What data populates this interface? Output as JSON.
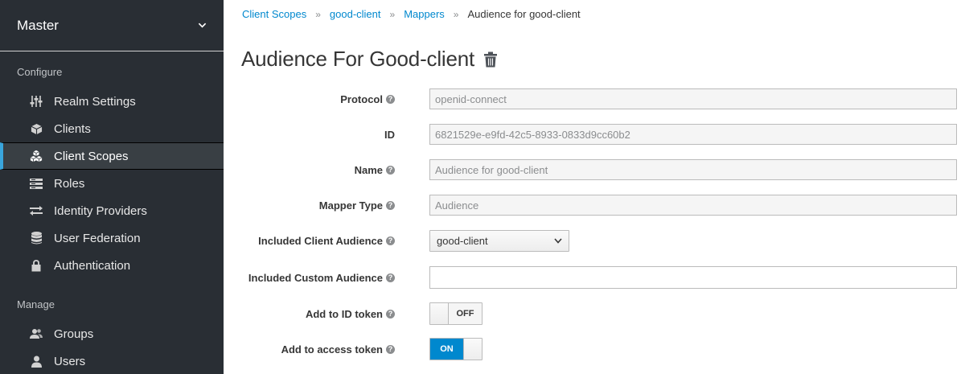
{
  "sidebar": {
    "realm": "Master",
    "configure_label": "Configure",
    "manage_label": "Manage",
    "configure_items": [
      {
        "label": "Realm Settings",
        "icon": "sliders-icon"
      },
      {
        "label": "Clients",
        "icon": "cube-icon"
      },
      {
        "label": "Client Scopes",
        "icon": "cubes-icon",
        "active": true
      },
      {
        "label": "Roles",
        "icon": "list-icon"
      },
      {
        "label": "Identity Providers",
        "icon": "exchange-icon"
      },
      {
        "label": "User Federation",
        "icon": "database-icon"
      },
      {
        "label": "Authentication",
        "icon": "lock-icon"
      }
    ],
    "manage_items": [
      {
        "label": "Groups",
        "icon": "users-icon"
      },
      {
        "label": "Users",
        "icon": "user-icon"
      }
    ]
  },
  "breadcrumb": {
    "items": [
      "Client Scopes",
      "good-client",
      "Mappers"
    ],
    "current": "Audience for good-client"
  },
  "page": {
    "title": "Audience For Good-client"
  },
  "form": {
    "protocol": {
      "label": "Protocol",
      "value": "openid-connect"
    },
    "id": {
      "label": "ID",
      "value": "6821529e-e9fd-42c5-8933-0833d9cc60b2"
    },
    "name": {
      "label": "Name",
      "value": "Audience for good-client"
    },
    "mapper_type": {
      "label": "Mapper Type",
      "value": "Audience"
    },
    "included_client_audience": {
      "label": "Included Client Audience",
      "value": "good-client"
    },
    "included_custom_audience": {
      "label": "Included Custom Audience",
      "value": ""
    },
    "add_to_id_token": {
      "label": "Add to ID token",
      "state": "OFF"
    },
    "add_to_access_token": {
      "label": "Add to access token",
      "state": "ON"
    }
  },
  "colors": {
    "sidebar_bg": "#292e34",
    "accent": "#0088ce",
    "active_bar": "#39a5dc"
  }
}
